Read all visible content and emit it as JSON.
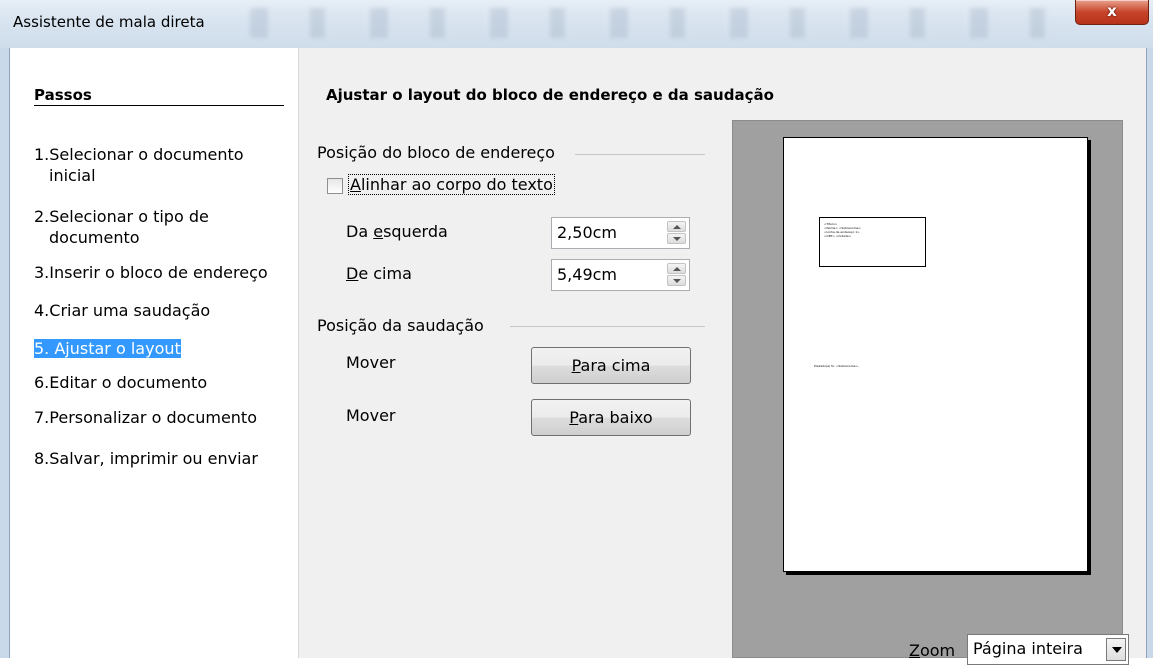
{
  "window": {
    "title": "Assistente de mala direta",
    "close_label": "x"
  },
  "sidebar": {
    "title": "Passos",
    "steps": [
      {
        "num": "1.",
        "label": "Selecionar o documento",
        "cont": "inicial"
      },
      {
        "num": "2.",
        "label": "Selecionar o tipo de",
        "cont": "documento"
      },
      {
        "num": "3.",
        "label": "Inserir o bloco de endereço",
        "cont": ""
      },
      {
        "num": "4.",
        "label": "Criar uma saudação",
        "cont": ""
      },
      {
        "num": "5.",
        "label": "Ajustar o layout",
        "cont": ""
      },
      {
        "num": "6.",
        "label": "Editar o documento",
        "cont": ""
      },
      {
        "num": "7.",
        "label": "Personalizar o documento",
        "cont": ""
      },
      {
        "num": "8.",
        "label": "Salvar, imprimir ou enviar",
        "cont": ""
      }
    ],
    "active_index": 4
  },
  "main": {
    "heading": "Ajustar o layout do bloco de endereço e da saudação",
    "address_group": {
      "title": "Posição do bloco de endereço",
      "align_checkbox": {
        "label_first": "A",
        "label_rest": "linhar ao corpo do texto",
        "checked": false
      },
      "from_left": {
        "label_pre": "Da ",
        "label_key": "e",
        "label_post": "squerda",
        "value": "2,50cm"
      },
      "from_top": {
        "label_key": "D",
        "label_post": "e cima",
        "value": "5,49cm"
      }
    },
    "salutation_group": {
      "title": "Posição da saudação",
      "move_label_1": "Mover",
      "move_label_2": "Mover",
      "up_button": {
        "key": "P",
        "rest": "ara cima"
      },
      "down_button": {
        "key": "P",
        "rest": "ara baixo"
      }
    },
    "preview": {
      "address_lines": [
        "<Título>",
        "<Nome> <Sobrenome>",
        "<Linha de endereço 1>",
        "<CEP> <Cidade>"
      ],
      "salutation": "Prezado(a) Sr. <Sobrenome>,"
    },
    "zoom": {
      "label_key": "Z",
      "label_rest": "oom",
      "value": "Página inteira"
    }
  }
}
